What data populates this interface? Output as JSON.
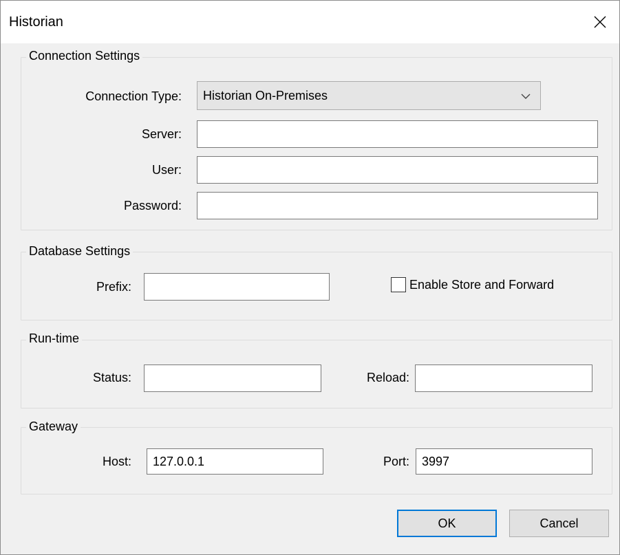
{
  "window": {
    "title": "Historian"
  },
  "connection": {
    "group_label": "Connection Settings",
    "type_label": "Connection Type:",
    "type_value": "Historian On-Premises",
    "server_label": "Server:",
    "server_value": "",
    "user_label": "User:",
    "user_value": "",
    "password_label": "Password:",
    "password_value": ""
  },
  "database": {
    "group_label": "Database Settings",
    "prefix_label": "Prefix:",
    "prefix_value": "",
    "store_forward_label": "Enable Store and Forward",
    "store_forward_checked": false
  },
  "runtime": {
    "group_label": "Run-time",
    "status_label": "Status:",
    "status_value": "",
    "reload_label": "Reload:",
    "reload_value": ""
  },
  "gateway": {
    "group_label": "Gateway",
    "host_label": "Host:",
    "host_value": "127.0.0.1",
    "port_label": "Port:",
    "port_value": "3997"
  },
  "buttons": {
    "ok": "OK",
    "cancel": "Cancel"
  },
  "icons": {
    "close": "close-icon",
    "dropdown": "chevron-down-icon"
  },
  "colors": {
    "focus_accent": "#0078d7",
    "dialog_bg": "#f0f0f0"
  }
}
